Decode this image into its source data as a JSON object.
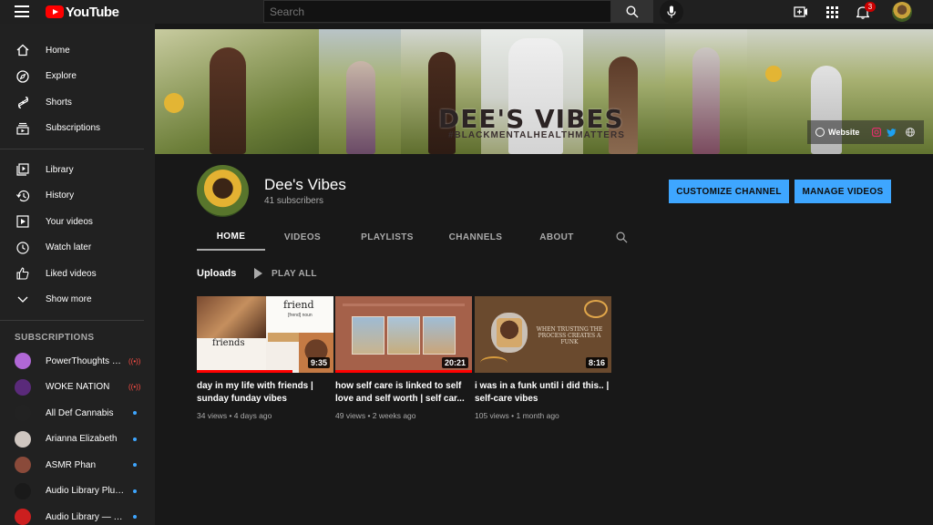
{
  "brand": {
    "name": "YouTube"
  },
  "search": {
    "placeholder": "Search"
  },
  "notifications": {
    "count": "3"
  },
  "sidebar": {
    "main": [
      {
        "label": "Home",
        "icon": "home-icon"
      },
      {
        "label": "Explore",
        "icon": "compass-icon"
      },
      {
        "label": "Shorts",
        "icon": "shorts-icon"
      },
      {
        "label": "Subscriptions",
        "icon": "subscriptions-icon"
      }
    ],
    "library": [
      {
        "label": "Library",
        "icon": "library-icon"
      },
      {
        "label": "History",
        "icon": "history-icon"
      },
      {
        "label": "Your videos",
        "icon": "your-videos-icon"
      },
      {
        "label": "Watch later",
        "icon": "watch-later-icon"
      },
      {
        "label": "Liked videos",
        "icon": "thumbs-up-icon"
      },
      {
        "label": "Show more",
        "icon": "chevron-down-icon"
      }
    ],
    "subscriptions_title": "SUBSCRIPTIONS",
    "subscriptions": [
      {
        "label": "PowerThoughts M...",
        "color": "#b067d6",
        "status": "live"
      },
      {
        "label": "WOKE NATION",
        "color": "#5a2a7a",
        "status": "live"
      },
      {
        "label": "All Def Cannabis",
        "color": "#222222",
        "status": "new"
      },
      {
        "label": "Arianna Elizabeth",
        "color": "#cfc6c0",
        "status": "new"
      },
      {
        "label": "ASMR Phan",
        "color": "#8a4a3a",
        "status": "new"
      },
      {
        "label": "Audio Library Plus ...",
        "color": "#1a1a1a",
        "status": "new"
      },
      {
        "label": "Audio Library — M...",
        "color": "#cc1f1f",
        "status": "new"
      }
    ]
  },
  "banner": {
    "title": "DEE'S VIBES",
    "tagline": "#BLACKMENTALHEALTHMATTERS",
    "website_label": "Website"
  },
  "channel": {
    "name": "Dee's Vibes",
    "subscribers": "41 subscribers",
    "customize_label": "CUSTOMIZE CHANNEL",
    "manage_label": "MANAGE VIDEOS"
  },
  "tabs": [
    "HOME",
    "VIDEOS",
    "PLAYLISTS",
    "CHANNELS",
    "ABOUT"
  ],
  "uploads": {
    "title": "Uploads",
    "play_all": "PLAY ALL",
    "videos": [
      {
        "title": "day in my life with friends | sunday funday vibes",
        "views": "34 views",
        "age": "4 days ago",
        "duration": "9:35",
        "watched": 0.7,
        "thumb_heading": "friend",
        "thumb_sub": "[frend] noun",
        "thumb_label": "friends"
      },
      {
        "title": "how self care is linked to self love and self worth | self car...",
        "views": "49 views",
        "age": "2 weeks ago",
        "duration": "20:21",
        "watched": 1.0
      },
      {
        "title": "i was in a funk until i did this.. | self-care vibes",
        "views": "105 views",
        "age": "1 month ago",
        "duration": "8:16",
        "watched": 0.0,
        "thumb_text": "WHEN TRUSTING THE PROCESS CREATES A FUNK"
      }
    ]
  },
  "colors": {
    "accent": "#3ea6ff",
    "brand_red": "#ff0000"
  }
}
